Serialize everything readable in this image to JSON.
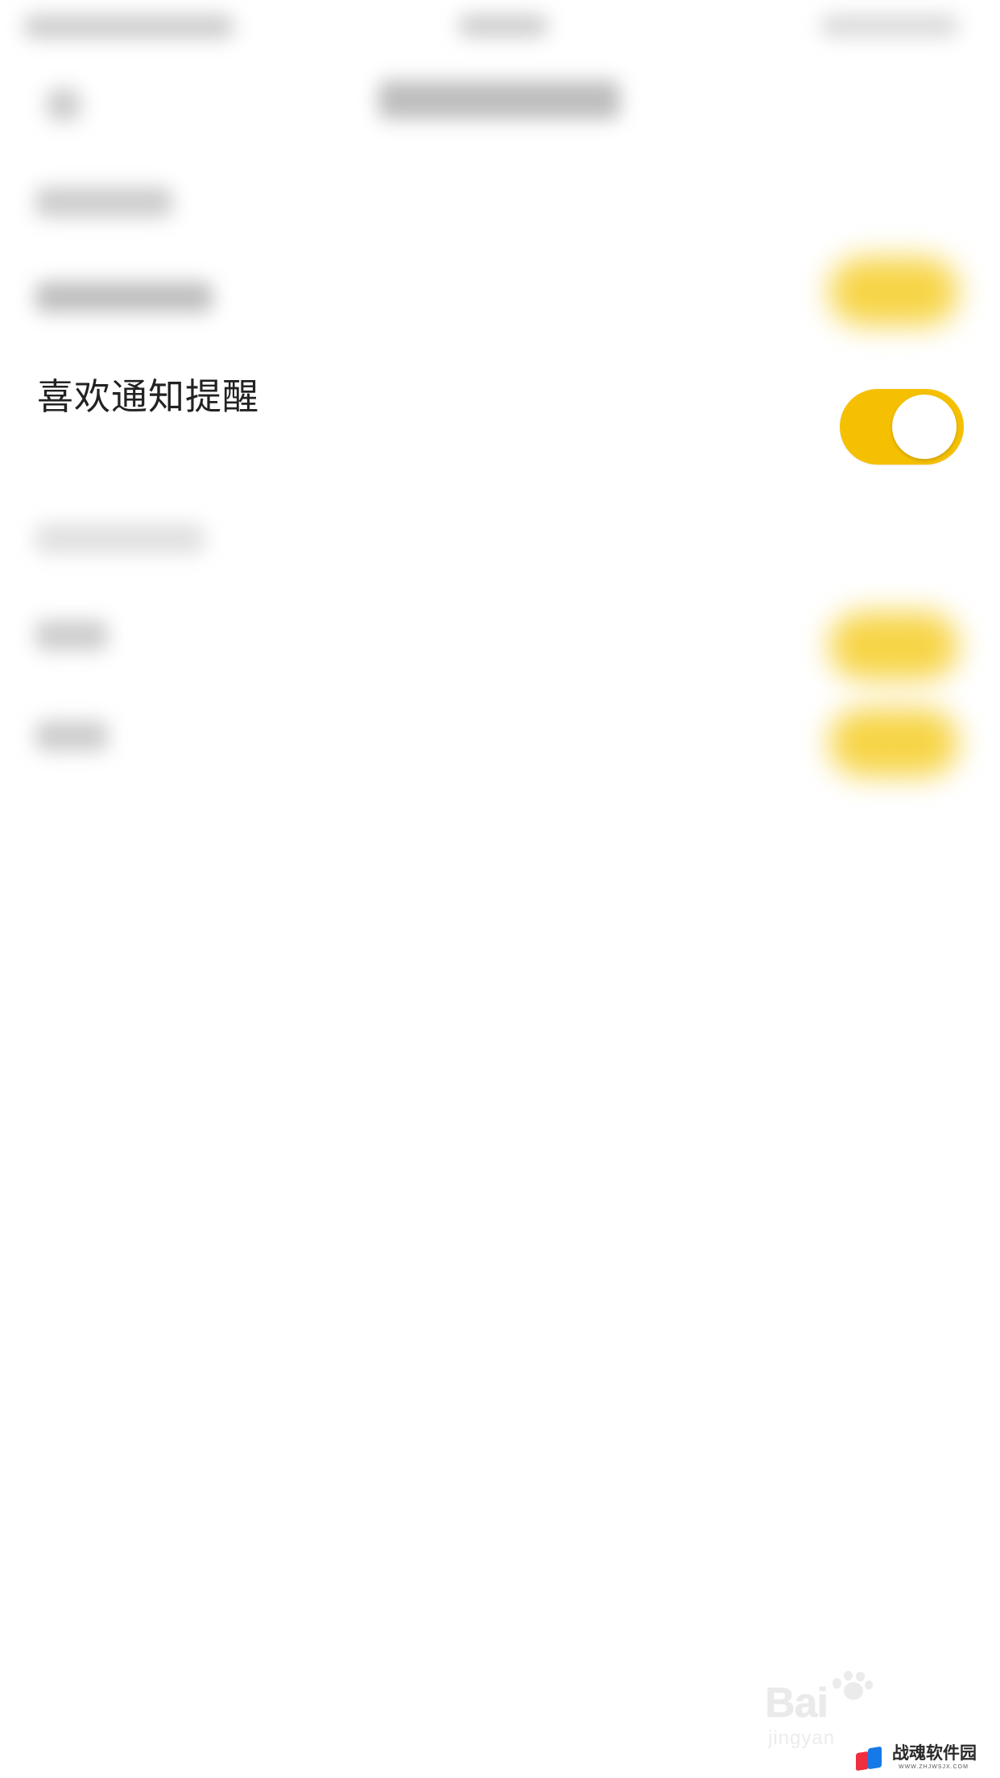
{
  "setting": {
    "label": "喜欢通知提醒",
    "enabled": true,
    "accent_color": "#f5c002"
  },
  "watermark": {
    "brand": "Bai",
    "tagline": "jingyan",
    "paw_icon": "baidu-paw-icon"
  },
  "site_logo": {
    "name": "战魂软件园",
    "url": "WWW.ZHJWSJX.COM",
    "icon": "site-logo-icon"
  }
}
